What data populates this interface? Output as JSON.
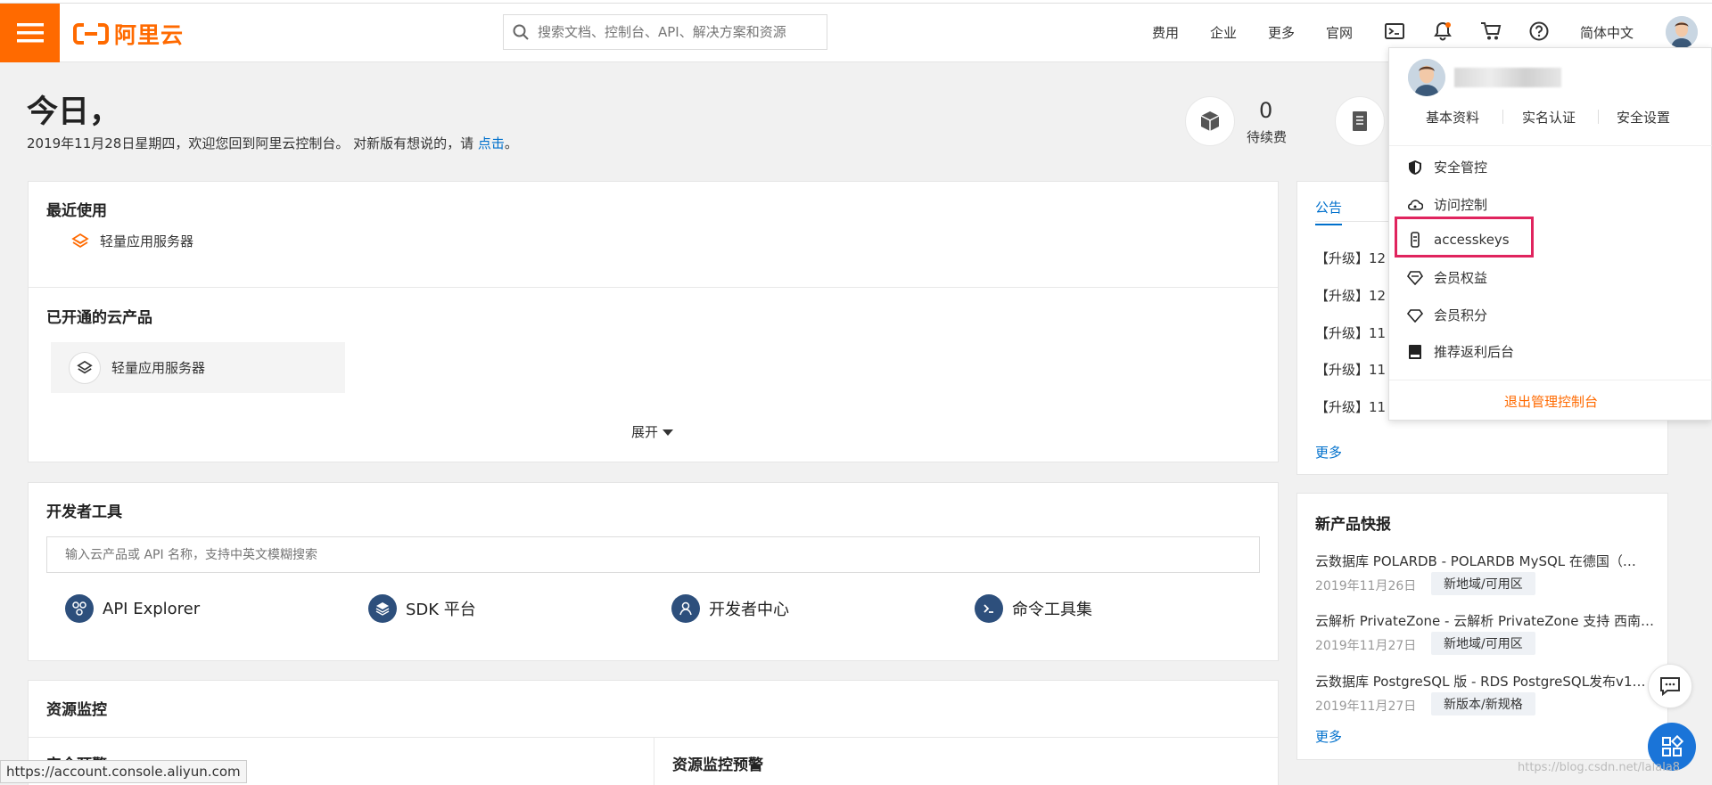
{
  "header": {
    "logo_text": "阿里云",
    "search_placeholder": "搜索文档、控制台、API、解决方案和资源",
    "nav": [
      "费用",
      "企业",
      "更多",
      "官网"
    ],
    "language": "简体中文"
  },
  "welcome": {
    "title": "今日，",
    "subtitle": "2019年11月28日星期四，欢迎您回到阿里云控制台。 对新版有想说的，请 ",
    "link": "点击",
    "suffix": "。",
    "stat_value": "0",
    "stat_label": "待续费"
  },
  "recent": {
    "title": "最近使用",
    "item": "轻量应用服务器"
  },
  "opened": {
    "title": "已开通的云产品",
    "item": "轻量应用服务器",
    "expand": "展开"
  },
  "devtools": {
    "title": "开发者工具",
    "input_placeholder": "输入云产品或 API 名称，支持中英文模糊搜索",
    "tools": [
      "API Explorer",
      "SDK 平台",
      "开发者中心",
      "命令工具集"
    ]
  },
  "monitor": {
    "title": "资源监控",
    "left_sub": "安全预警",
    "right_sub": "资源监控预警"
  },
  "notice": {
    "tab": "公告",
    "tab2_partial": "：",
    "rows": [
      "【升级】12",
      "【升级】12",
      "【升级】11",
      "【升级】11",
      "【升级】11"
    ],
    "more": "更多"
  },
  "new_products": {
    "title": "新产品快报",
    "items": [
      {
        "title": "云数据库 POLARDB - POLARDB MySQL 在德国（…",
        "date": "2019年11月26日",
        "tag": "新地域/可用区"
      },
      {
        "title": "云解析 PrivateZone - 云解析 PrivateZone 支持 西南…",
        "date": "2019年11月27日",
        "tag": "新地域/可用区"
      },
      {
        "title": "云数据库 PostgreSQL 版 - RDS PostgreSQL发布v1…",
        "date": "2019年11月27日",
        "tag": "新版本/新规格"
      }
    ],
    "more": "更多"
  },
  "dropdown": {
    "links": [
      "基本资料",
      "实名认证",
      "安全设置"
    ],
    "items": [
      {
        "label": "安全管控",
        "icon": "shield-icon"
      },
      {
        "label": "访问控制",
        "icon": "cloud-icon"
      },
      {
        "label": "accesskeys",
        "icon": "key-icon"
      },
      {
        "label": "会员权益",
        "icon": "diamond-icon"
      },
      {
        "label": "会员积分",
        "icon": "gem-icon"
      },
      {
        "label": "推荐返利后台",
        "icon": "book-icon"
      }
    ],
    "logout": "退出管理控制台"
  },
  "status_url": "https://account.console.aliyun.com",
  "watermark": "https://blog.csdn.net/lalala8",
  "colors": {
    "brand": "#ff6a00",
    "link": "#0070cc",
    "highlight": "#e0245e",
    "fab": "#1a74d8"
  }
}
